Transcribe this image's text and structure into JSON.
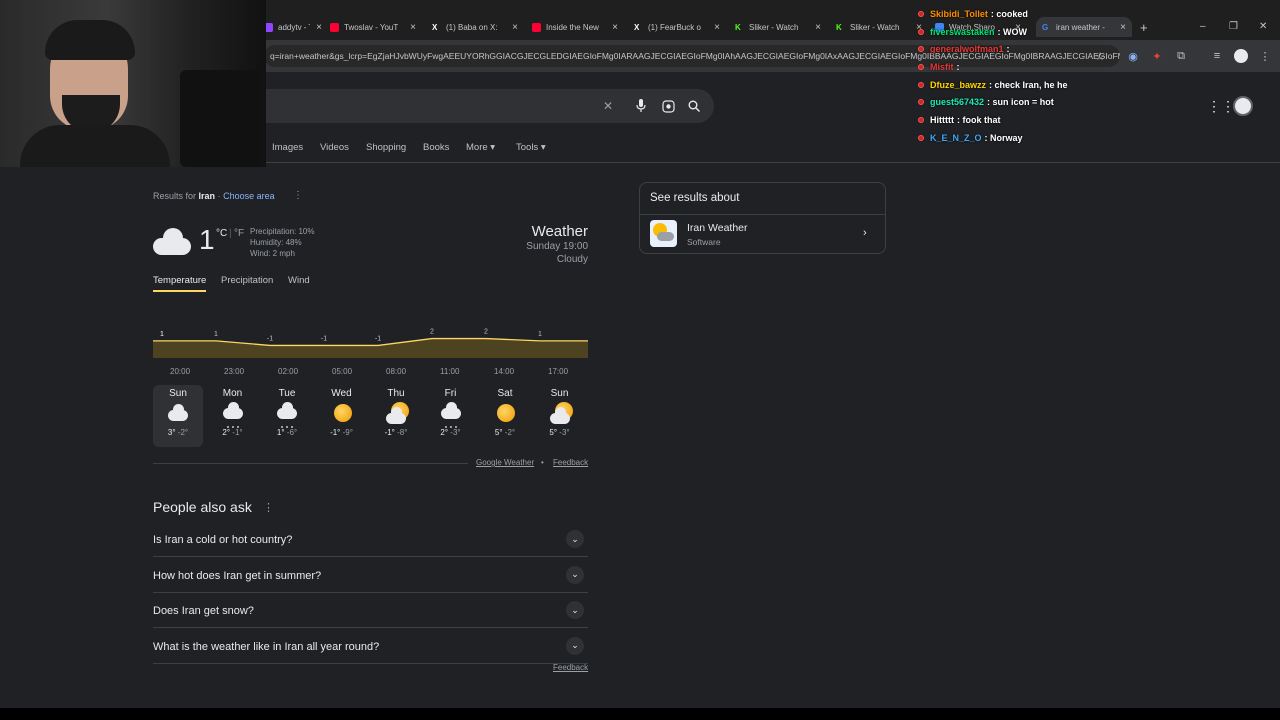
{
  "tabs": [
    {
      "title": "addytv - T",
      "color": "#9146ff"
    },
    {
      "title": "Twoslav - YouT",
      "color": "#ff0033"
    },
    {
      "title": "(1) Baba on X:",
      "color": "#ffffff",
      "glyph": "X"
    },
    {
      "title": "Inside the New",
      "color": "#ff0033"
    },
    {
      "title": "(1) FearBuck o",
      "color": "#ffffff",
      "glyph": "X"
    },
    {
      "title": "Sliker - Watch",
      "color": "#53fc18",
      "glyph": "K"
    },
    {
      "title": "Sliker - Watch",
      "color": "#53fc18",
      "glyph": "K"
    },
    {
      "title": "Watch Sharo",
      "color": "#4285f4"
    },
    {
      "title": "iran weather -",
      "color": "#4285f4",
      "glyph": "G",
      "active": true
    }
  ],
  "new_tab": "+",
  "window_controls": [
    "–",
    "❐",
    "✕"
  ],
  "url": "q=iran+weather&gs_lcrp=EgZjaHJvbWUyFwgAEEUYORhGGIACGJECGLEDGIAEGIoFMg0IARAAGJECGIAEGIoFMg0IAhAAGJECGIAEGIoFMg0IAxAAGJECGIAEGIoFMg0IBBAAGJECGIAEGIoFMg0IBRAAGJECGIAEGIoFMg0IBh...",
  "nav": {
    "items": [
      "Images",
      "Videos",
      "Shopping",
      "Books",
      "More ▾",
      "Tools ▾"
    ]
  },
  "results_for": {
    "prefix": "Results for",
    "place": "Iran",
    "sep": "·",
    "choose": "Choose area"
  },
  "weather": {
    "temp": "1",
    "unit_c": "°C",
    "unit_sep": "|",
    "unit_f": "°F",
    "precipitation": "Precipitation: 10%",
    "humidity": "Humidity: 48%",
    "wind": "Wind: 2 mph",
    "title": "Weather",
    "time": "Sunday 19:00",
    "condition": "Cloudy",
    "tabs": [
      "Temperature",
      "Precipitation",
      "Wind"
    ],
    "chart_labels": [
      "1",
      "1",
      "-1",
      "-1",
      "-1",
      "2",
      "2",
      "1"
    ],
    "chart_values": [
      1,
      1,
      -1,
      -1,
      -1,
      2,
      2,
      1
    ],
    "times": [
      "20:00",
      "23:00",
      "02:00",
      "05:00",
      "08:00",
      "11:00",
      "14:00",
      "17:00"
    ],
    "days": [
      {
        "name": "Sun",
        "icon": "cloud-icon",
        "hi": "3°",
        "lo": "-2°"
      },
      {
        "name": "Mon",
        "icon": "snow-cloud-icon",
        "hi": "2°",
        "lo": "-1°"
      },
      {
        "name": "Tue",
        "icon": "snow-cloud-icon",
        "hi": "1°",
        "lo": "-6°"
      },
      {
        "name": "Wed",
        "icon": "sun-icon",
        "hi": "-1°",
        "lo": "-9°"
      },
      {
        "name": "Thu",
        "icon": "partly-cloudy-icon",
        "hi": "-1°",
        "lo": "-8°"
      },
      {
        "name": "Fri",
        "icon": "snow-cloud-icon",
        "hi": "2°",
        "lo": "-3°"
      },
      {
        "name": "Sat",
        "icon": "sun-icon",
        "hi": "5°",
        "lo": "-2°"
      },
      {
        "name": "Sun",
        "icon": "partly-cloudy-icon",
        "hi": "5°",
        "lo": "-3°"
      }
    ],
    "source": "Google Weather",
    "dot": "•",
    "feedback": "Feedback"
  },
  "see_results": {
    "heading": "See results about",
    "title": "Iran Weather",
    "subtitle": "Software"
  },
  "paa": {
    "heading": "People also ask",
    "questions": [
      "Is Iran a cold or hot country?",
      "How hot does Iran get in summer?",
      "Does Iran get snow?",
      "What is the weather like in Iran all year round?"
    ],
    "feedback": "Feedback"
  },
  "chat": [
    {
      "user": "Skibidi_Tollet",
      "color": "#ff8c00",
      "msg": ": cooked"
    },
    {
      "user": "fiverswastaken",
      "color": "#00e676",
      "msg": ": WOW"
    },
    {
      "user": "generalwolfman1",
      "color": "#e53935",
      "msg": ":"
    },
    {
      "user": "Misfit",
      "color": "#e53935",
      "msg": ":"
    },
    {
      "user": "Dfuze_bawzz",
      "color": "#ffd600",
      "msg": ": check Iran, he he"
    },
    {
      "user": "guest567432",
      "color": "#1de9b6",
      "msg": ": sun icon = hot"
    },
    {
      "user": "Hittttt",
      "color": "#ffffff",
      "msg": ": fook that"
    },
    {
      "user": "K_E_N_Z_O",
      "color": "#42a5f5",
      "msg": ": Norway"
    }
  ],
  "colors": {
    "accent": "#8ab4f8",
    "chart_line": "#fdd663",
    "chart_fill": "#4d4320",
    "tab_underline": "#fdd663"
  }
}
